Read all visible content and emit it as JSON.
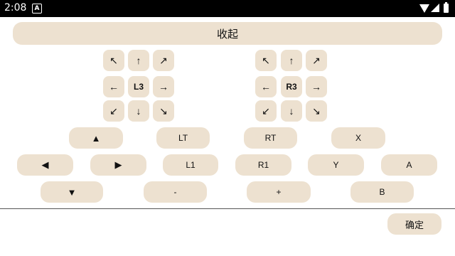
{
  "status_bar": {
    "time": "2:08",
    "notification_icon": "A"
  },
  "collapse_button": {
    "label": "收起"
  },
  "left_stick": {
    "up_left": "↖",
    "up": "↑",
    "up_right": "↗",
    "left": "←",
    "center": "L3",
    "right": "→",
    "down_left": "↙",
    "down": "↓",
    "down_right": "↘"
  },
  "right_stick": {
    "up_left": "↖",
    "up": "↑",
    "up_right": "↗",
    "left": "←",
    "center": "R3",
    "right": "→",
    "down_left": "↙",
    "down": "↓",
    "down_right": "↘"
  },
  "dpad": {
    "up": "▲",
    "left": "◀",
    "right": "▶",
    "down": "▼"
  },
  "buttons": {
    "lt": "LT",
    "rt": "RT",
    "x": "X",
    "l1": "L1",
    "r1": "R1",
    "y": "Y",
    "a": "A",
    "minus": "-",
    "plus": "+",
    "b": "B"
  },
  "footer": {
    "confirm_label": "确定"
  },
  "colors": {
    "button_bg": "#ede1d0",
    "status_bar_bg": "#000000"
  }
}
